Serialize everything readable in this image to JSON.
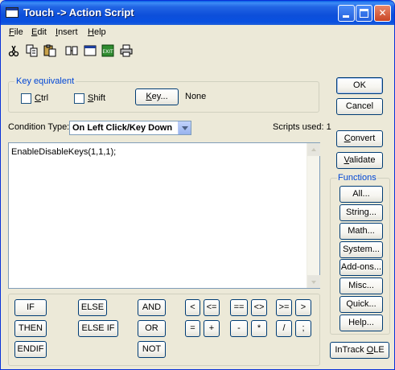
{
  "window": {
    "title": "Touch -> Action Script"
  },
  "menu": [
    {
      "u": "F",
      "rest": "ile"
    },
    {
      "u": "E",
      "rest": "dit"
    },
    {
      "u": "I",
      "rest": "nsert"
    },
    {
      "u": "H",
      "rest": "elp"
    }
  ],
  "toolbar": {
    "icons": [
      "cut-icon",
      "copy-icon",
      "paste-icon",
      "find-icon",
      "window-icon",
      "exit-icon",
      "print-icon"
    ]
  },
  "key_equivalent": {
    "label": "Key equivalent",
    "ctrl_u": "C",
    "ctrl_rest": "trl",
    "shift_u": "S",
    "shift_rest": "hift",
    "key_u": "K",
    "key_rest": "ey...",
    "key_value": "None"
  },
  "condition": {
    "label": "Condition Type:",
    "value": "On Left Click/Key Down",
    "scripts_used": "Scripts used: 1"
  },
  "editor": {
    "text": "EnableDisableKeys(1,1,1);"
  },
  "side_buttons": {
    "ok": "OK",
    "cancel": "Cancel",
    "convert_u": "C",
    "convert_rest": "onvert",
    "validate_u": "V",
    "validate_rest": "alidate"
  },
  "functions": {
    "label": "Functions",
    "all": "All...",
    "string": "String...",
    "math": "Math...",
    "system": "System...",
    "addons": "Add-ons...",
    "misc": "Misc...",
    "quick": "Quick...",
    "help": "Help..."
  },
  "intrack": {
    "pre": "InTrack ",
    "u": "O",
    "post": "LE"
  },
  "keywords": {
    "if": "IF",
    "then": "THEN",
    "endif": "ENDIF",
    "else": "ELSE",
    "else_if": "ELSE IF",
    "and": "AND",
    "or": "OR",
    "not": "NOT"
  },
  "operators": {
    "lt": "<",
    "le": "<=",
    "eq": "==",
    "ne": "<>",
    "ge": ">=",
    "gt": ">",
    "assign": "=",
    "plus": "+",
    "minus": "-",
    "times": "*",
    "div": "/",
    "semi": ";"
  }
}
